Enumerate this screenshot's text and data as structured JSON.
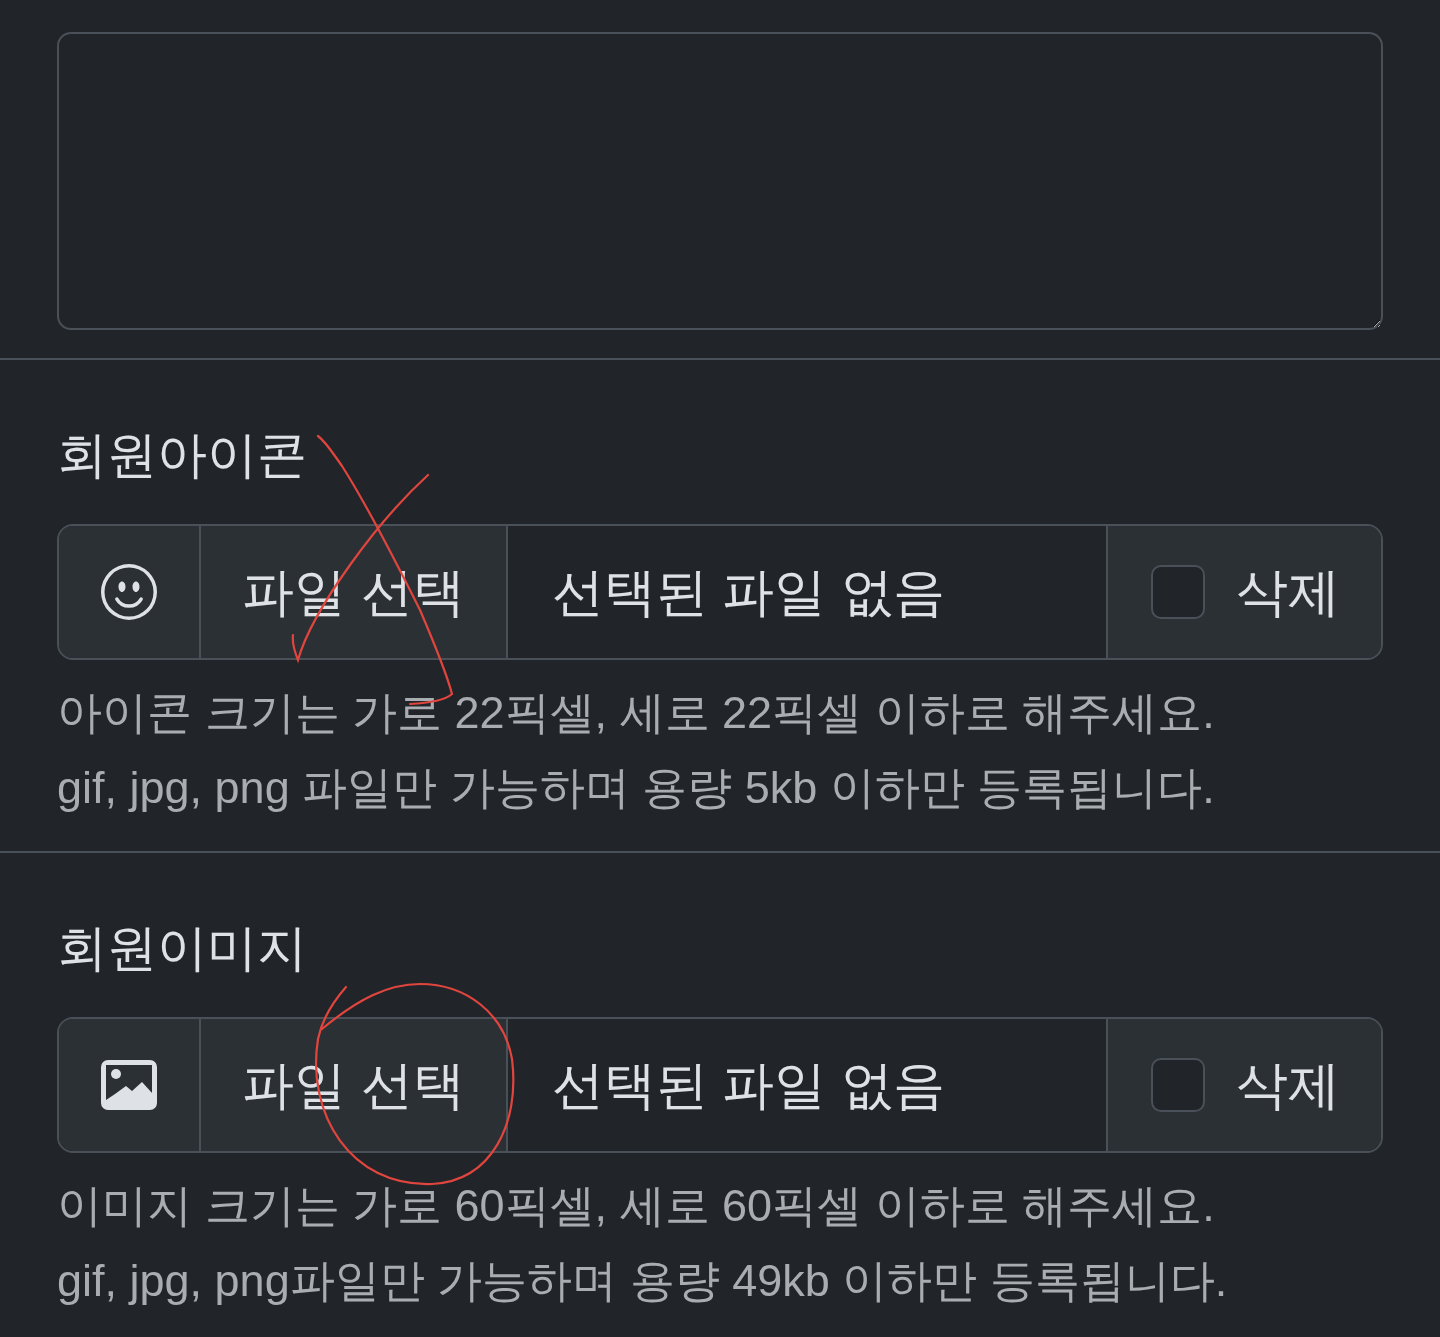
{
  "sections": [
    {
      "kind": "icon",
      "label": "회원아이콘",
      "file_button": "파일 선택",
      "file_status": "선택된 파일 없음",
      "delete": {
        "label": "삭제",
        "checked": false
      },
      "help": [
        "아이콘 크기는 가로 22픽셀, 세로 22픽셀 이하로 해주세요.",
        "gif, jpg, png 파일만 가능하며 용량 5kb 이하만 등록됩니다."
      ],
      "annotation": {
        "kind": "cross"
      }
    },
    {
      "kind": "image",
      "label": "회원이미지",
      "file_button": "파일 선택",
      "file_status": "선택된 파일 없음",
      "delete": {
        "label": "삭제",
        "checked": false
      },
      "help": [
        "이미지 크기는 가로 60픽셀, 세로 60픽셀 이하로 해주세요.",
        "gif, jpg, png파일만 가능하며 용량 49kb 이하만 등록됩니다."
      ],
      "annotation": {
        "kind": "circle"
      }
    }
  ]
}
